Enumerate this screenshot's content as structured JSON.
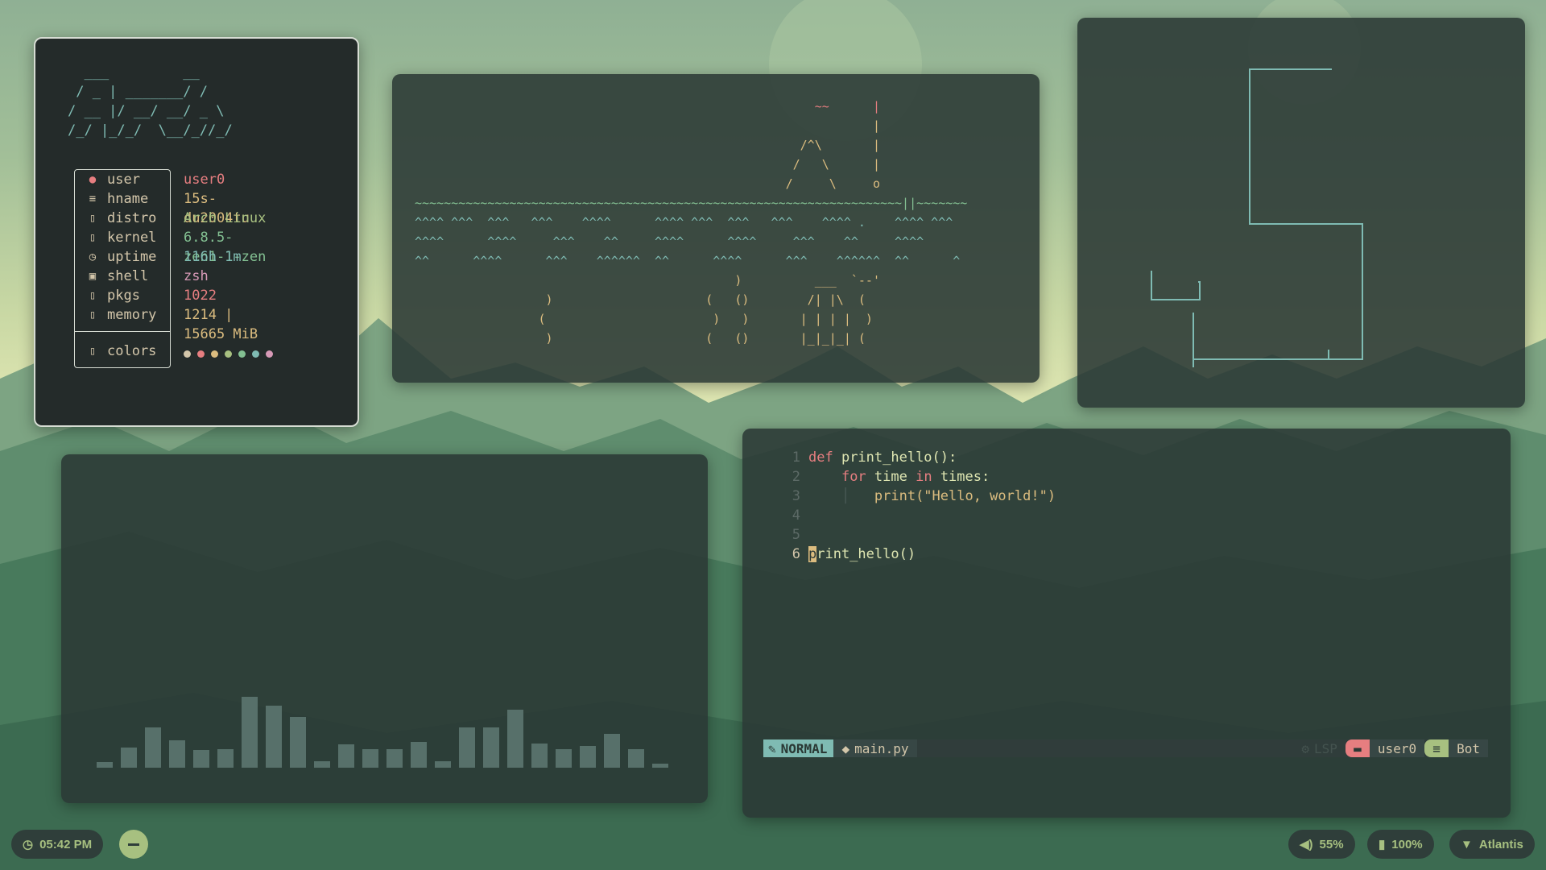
{
  "theme": {
    "accent": "#7fbbb3",
    "red": "#e67e80",
    "yellow": "#dbbc7f",
    "green": "#a7c080",
    "purple": "#d699b6",
    "orange": "#e69875"
  },
  "fetch": {
    "logo": "  ___         __\n / _ | _______/ /\n/ __ |/ __/ __/ _ \\\n/_/ |_/_/  \\__/_//_/",
    "keys": [
      {
        "icon": "user-icon",
        "glyph": "●",
        "label": "user"
      },
      {
        "icon": "hostname-icon",
        "glyph": "≡",
        "label": "hname"
      },
      {
        "icon": "distro-icon",
        "glyph": "▯",
        "label": "distro"
      },
      {
        "icon": "kernel-icon",
        "glyph": "▯",
        "label": "kernel"
      },
      {
        "icon": "clock-icon",
        "glyph": "◷",
        "label": "uptime"
      },
      {
        "icon": "terminal-icon",
        "glyph": "▣",
        "label": "shell"
      },
      {
        "icon": "package-icon",
        "glyph": "▯",
        "label": "pkgs"
      },
      {
        "icon": "memory-icon",
        "glyph": "▯",
        "label": "memory"
      }
    ],
    "colors_key": {
      "icon": "palette-icon",
      "glyph": "▯",
      "label": "colors"
    },
    "values": [
      "user0",
      "15s-du2004tu",
      "Arch Linux",
      "6.8.5-zen1-1-zen",
      "116h 1m",
      "zsh",
      "1022",
      "1214 | 15665 MiB"
    ],
    "value_colors": [
      "#e67e80",
      "#dbbc7f",
      "#a7c080",
      "#83c092",
      "#7fbbb3",
      "#d699b6",
      "#e67e80",
      "#dbbc7f"
    ],
    "palette": [
      "#d3c6aa",
      "#e67e80",
      "#dbbc7f",
      "#a7c080",
      "#83c092",
      "#7fbbb3",
      "#d699b6"
    ]
  },
  "ascii_art": {
    "lines": [
      "                                                       ~~      |",
      "                                                               |",
      "                                                     /^\\       |",
      "                                                    /   \\      |",
      "                                                   /     \\     o",
      "~~~~~~~~~~~~~~~~~~~~~~~~~~~~~~~~~~~~~~~~~~~~~~~~~~~~~~~~~~~~~~~~~~~||~~~~~~~",
      "^^^^ ^^^  ^^^   ^^^    ^^^^      ^^^^ ^^^  ^^^   ^^^    ^^^^ .    ^^^^ ^^^",
      "^^^^      ^^^^     ^^^    ^^     ^^^^      ^^^^     ^^^    ^^     ^^^^",
      "^^      ^^^^      ^^^    ^^^^^^  ^^      ^^^^      ^^^    ^^^^^^  ^^      ^",
      "                                            )          ___  `--'",
      "                  )                     (   ()        /| |\\  (",
      "                 (                       )   )       | | | |  )",
      "                  )                     (   ()       |_|_|_| ("
    ]
  },
  "editor": {
    "lines": [
      {
        "n": "1",
        "parts": [
          {
            "c": "kw",
            "t": "def "
          },
          {
            "c": "fn",
            "t": "print_hello():"
          }
        ]
      },
      {
        "n": "2",
        "parts": [
          {
            "c": "",
            "t": "    "
          },
          {
            "c": "kw",
            "t": "for "
          },
          {
            "c": "fn",
            "t": "time "
          },
          {
            "c": "kw",
            "t": "in "
          },
          {
            "c": "fn",
            "t": "times:"
          }
        ]
      },
      {
        "n": "3",
        "parts": [
          {
            "c": "",
            "t": "    │   "
          },
          {
            "c": "str",
            "t": "print(\"Hello, world!\")"
          }
        ]
      },
      {
        "n": "4",
        "parts": []
      },
      {
        "n": "5",
        "parts": []
      },
      {
        "n": "6",
        "parts": [
          {
            "c": "cur",
            "t": "p"
          },
          {
            "c": "fn",
            "t": "rint_hello()"
          }
        ]
      }
    ],
    "status": {
      "mode": "NORMAL",
      "file": "main.py",
      "lsp": "LSP",
      "user": "user0",
      "position": "Bot"
    }
  },
  "visualizer": {
    "levels": [
      0.08,
      0.28,
      0.55,
      0.38,
      0.24,
      0.26,
      0.98,
      0.85,
      0.7,
      0.09,
      0.32,
      0.26,
      0.25,
      0.36,
      0.09,
      0.55,
      0.55,
      0.8,
      0.33,
      0.26,
      0.3,
      0.47,
      0.26,
      0.05
    ]
  },
  "bar": {
    "clock": "05:42 PM",
    "volume": "55%",
    "battery": "100%",
    "network": "Atlantis"
  }
}
